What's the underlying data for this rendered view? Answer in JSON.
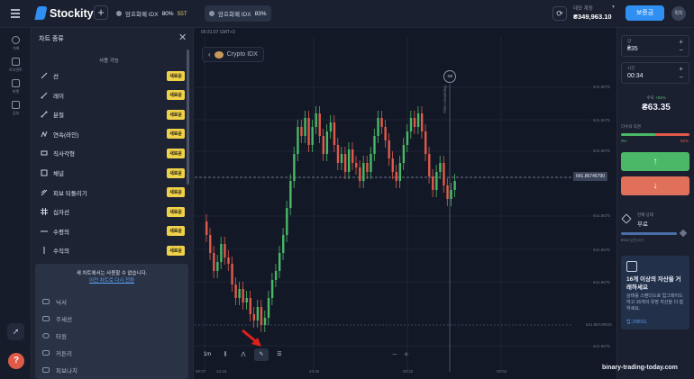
{
  "header": {
    "logo": "Stockity",
    "tabs": [
      {
        "name": "암호화폐 IDX",
        "payout": "80%",
        "timer": "55T"
      },
      {
        "name": "암호화폐 IDX",
        "payout": "83%"
      }
    ],
    "account_label": "데모 계정",
    "balance": "₴349,963.10",
    "deposit_label": "보증금",
    "avatar": "위치"
  },
  "rail": [
    {
      "label": "거래",
      "icon": "clock-icon"
    },
    {
      "label": "토너먼트",
      "icon": "trophy-icon"
    },
    {
      "label": "마켓",
      "icon": "market-icon"
    },
    {
      "label": "공부",
      "icon": "book-icon"
    }
  ],
  "panel": {
    "title": "차트 종류",
    "subtitle": "사용 가능",
    "badge": "새로운",
    "tools": [
      {
        "label": "선",
        "icon": "line-tool-icon"
      },
      {
        "label": "레이",
        "icon": "ray-tool-icon"
      },
      {
        "label": "분절",
        "icon": "segment-tool-icon"
      },
      {
        "label": "연속(라인)",
        "icon": "polyline-tool-icon"
      },
      {
        "label": "직사각형",
        "icon": "rectangle-tool-icon"
      },
      {
        "label": "채널",
        "icon": "channel-tool-icon"
      },
      {
        "label": "피보 되돌리기",
        "icon": "fibonacci-tool-icon"
      },
      {
        "label": "십자선",
        "icon": "crosshair-tool-icon"
      },
      {
        "label": "수평의",
        "icon": "horizontal-line-tool-icon"
      },
      {
        "label": "수직의",
        "icon": "vertical-line-tool-icon"
      }
    ],
    "notice": "새 차트에서는 사용할 수 없습니다.",
    "notice_link": "이전 차트로 다시 전환",
    "extra_items": [
      "닉서",
      "주세선",
      "타원",
      "커튼리",
      "피보나치"
    ]
  },
  "chart": {
    "timestamp": "00:31:07 GMT+3",
    "asset": "Crypto IDX",
    "current_price": "641.86746790",
    "countdown": ":50",
    "time_remaining": "Time remaining",
    "timeframe": "1m",
    "y_labels": [
      "641.8675",
      "641.8675",
      "641.8675",
      "641.8675",
      "641.8675",
      "641.8675",
      "641.86749515",
      "641.8675"
    ],
    "x_labels": [
      "00:07",
      "23:16",
      "23:46",
      "00:20",
      "00:52"
    ]
  },
  "chart_data": {
    "type": "candlestick",
    "note_series": "OHLC candles",
    "title": "",
    "xlabel": "",
    "ylabel": ""
  },
  "trade": {
    "amount_label": "양",
    "amount": "₴35",
    "time_label": "시간",
    "time": "00:34",
    "profit_label": "수익",
    "profit_pct": "+81%",
    "profit_value": "₴63.35",
    "sentiment_label": "다수의 의견",
    "sentiment_up": "0%",
    "sentiment_down": "92%",
    "sentiment_up_fraction": 0.5,
    "up_label": "↑",
    "down_label": "↓",
    "status_label": "현재 상태",
    "status_value": "무료",
    "xp_text": "₴350 남은(XP)",
    "promo_title": "16개 이상의 자산을 거래하세요",
    "promo_body": "상태를 스탠다드로 업그레이드하고 16개의 유망 자산을 더 잡하세요.",
    "promo_link": "업그레이드"
  },
  "watermark": "binary-trading-today.com",
  "colors": {
    "accent": "#2f8ff2",
    "up": "#4ab866",
    "down": "#e05a4a",
    "badge": "#f0d24a"
  }
}
